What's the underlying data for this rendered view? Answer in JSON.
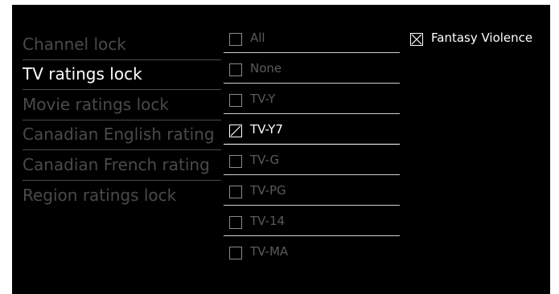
{
  "menu": {
    "items": [
      {
        "label": "Channel lock",
        "active": false
      },
      {
        "label": "TV ratings lock",
        "active": true
      },
      {
        "label": "Movie ratings lock",
        "active": false
      },
      {
        "label": "Canadian English rating",
        "active": false
      },
      {
        "label": "Canadian French rating",
        "active": false
      },
      {
        "label": "Region ratings lock",
        "active": false
      }
    ]
  },
  "ratings": {
    "items": [
      {
        "label": "All",
        "checked": false,
        "selected": false
      },
      {
        "label": "None",
        "checked": false,
        "selected": false
      },
      {
        "label": "TV-Y",
        "checked": false,
        "selected": false
      },
      {
        "label": "TV-Y7",
        "checked": "partial",
        "selected": true
      },
      {
        "label": "TV-G",
        "checked": false,
        "selected": false
      },
      {
        "label": "TV-PG",
        "checked": false,
        "selected": false
      },
      {
        "label": "TV-14",
        "checked": false,
        "selected": false
      },
      {
        "label": "TV-MA",
        "checked": false,
        "selected": false
      }
    ]
  },
  "content_descriptors": {
    "items": [
      {
        "label": "Fantasy Violence",
        "checked": true
      }
    ]
  },
  "colors": {
    "background": "#000000",
    "active_text": "#ffffff",
    "inactive_text": "#4a4a4a"
  }
}
